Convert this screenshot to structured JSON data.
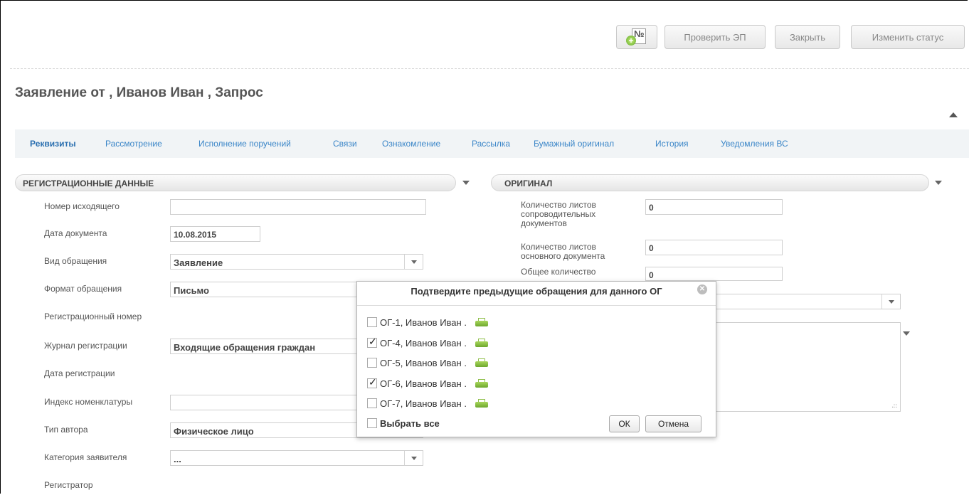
{
  "toolbar": {
    "check_ep": "Проверить ЭП",
    "close": "Закрыть",
    "change_status": "Изменить статус",
    "number_icon_text": "№"
  },
  "document": {
    "title": "Заявление от , Иванов Иван , Запрос"
  },
  "tabs": [
    {
      "label": "Реквизиты",
      "active": true
    },
    {
      "label": "Рассмотрение"
    },
    {
      "label": "Исполнение поручений"
    },
    {
      "label": "Связи"
    },
    {
      "label": "Ознакомление"
    },
    {
      "label": "Рассылка"
    },
    {
      "label": "Бумажный оригинал"
    },
    {
      "label": "История"
    },
    {
      "label": "Уведомления ВС"
    }
  ],
  "registration": {
    "header": "РЕГИСТРАЦИОННЫЕ ДАННЫЕ",
    "fields": {
      "outgoing_number": {
        "label": "Номер исходящего",
        "value": ""
      },
      "doc_date": {
        "label": "Дата документа",
        "value": "10.08.2015"
      },
      "appeal_type": {
        "label": "Вид обращения",
        "value": "Заявление"
      },
      "appeal_format": {
        "label": "Формат обращения",
        "value": "Письмо"
      },
      "reg_number": {
        "label": "Регистрационный номер"
      },
      "journal": {
        "label": "Журнал регистрации",
        "value": "Входящие обращения граждан"
      },
      "reg_date": {
        "label": "Дата регистрации"
      },
      "nomenclature": {
        "label": "Индекс номенклатуры",
        "value": ""
      },
      "author_type": {
        "label": "Тип автора",
        "value": "Физическое лицо"
      },
      "applicant_category": {
        "label": "Категория заявителя",
        "value": "..."
      },
      "registrar": {
        "label": "Регистратор"
      }
    }
  },
  "original": {
    "header": "ОРИГИНАЛ",
    "cover_sheets": {
      "label_1": "Количество листов",
      "label_2": "сопроводительных",
      "label_3": "документов",
      "value": "0"
    },
    "main_sheets": {
      "label_1": "Количество листов",
      "label_2": "основного документа",
      "value": "0"
    },
    "total": {
      "label_1": "Общее количество",
      "value": "0"
    }
  },
  "dialog": {
    "title": "Подтвердите предыдущие обращения для данного ОГ",
    "items": [
      {
        "label": "ОГ-1, Иванов Иван .",
        "checked": false
      },
      {
        "label": "ОГ-4, Иванов Иван .",
        "checked": true
      },
      {
        "label": "ОГ-5, Иванов Иван .",
        "checked": false
      },
      {
        "label": "ОГ-6, Иванов Иван .",
        "checked": true
      },
      {
        "label": "ОГ-7, Иванов Иван .",
        "checked": false
      }
    ],
    "select_all": "Выбрать все",
    "ok": "ОК",
    "cancel": "Отмена"
  },
  "colors": {
    "accent_tab": "#3b86c8",
    "tabbar_bg": "#f1f4f6",
    "printer_green": "#8fbf4a"
  }
}
